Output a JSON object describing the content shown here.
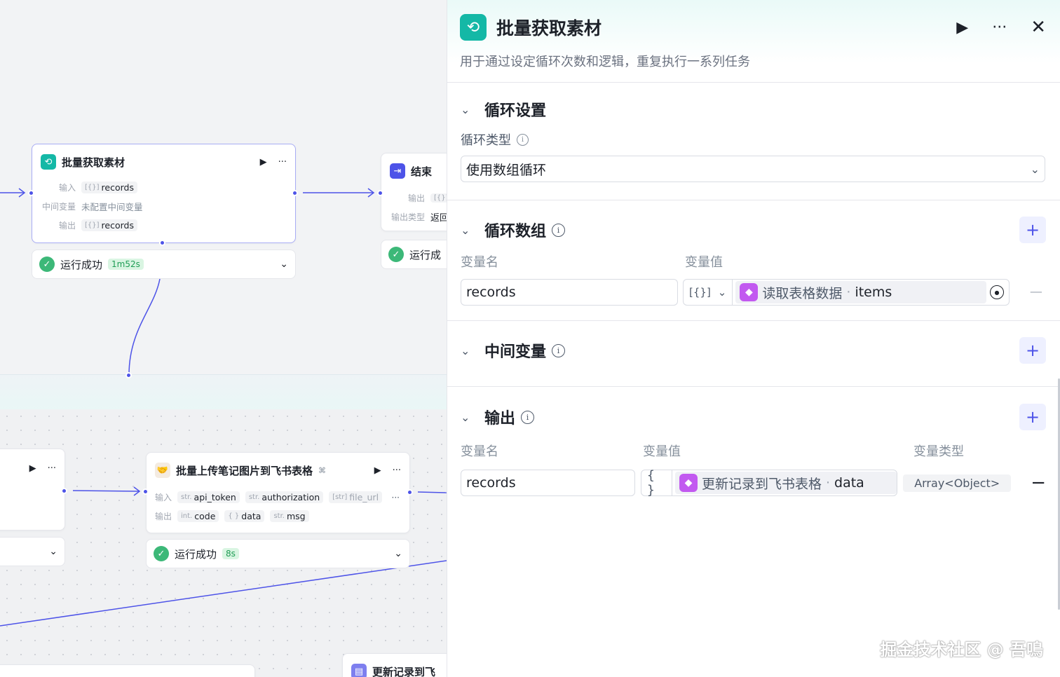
{
  "canvas": {
    "loop_node": {
      "title": "批量获取素材",
      "input_label": "输入",
      "input_type": "[{}]",
      "input_value": "records",
      "mid_label": "中间变量",
      "mid_value": "未配置中间变量",
      "output_label": "输出",
      "output_type": "[{}]",
      "output_value": "records",
      "status": "运行成功",
      "time": "1m52s"
    },
    "end_node": {
      "title": "结束",
      "output_label": "输出",
      "output_type": "[{}]",
      "output_type_label": "输出类型",
      "output_type_value": "返回",
      "status": "运行成"
    },
    "upload_node": {
      "title": "批量上传笔记图片到飞书表格",
      "input_label": "输入",
      "inputs": [
        {
          "type": "str.",
          "name": "api_token"
        },
        {
          "type": "str.",
          "name": "authorization"
        },
        {
          "type": "[str]",
          "name": "file_url"
        }
      ],
      "more": "···",
      "output_label": "输出",
      "outputs": [
        {
          "type": "int.",
          "name": "code"
        },
        {
          "type": "{ }",
          "name": "data"
        },
        {
          "type": "str.",
          "name": "msg"
        }
      ],
      "status": "运行成功",
      "time": "8s"
    },
    "bottom_node": {
      "title": "更新记录到飞"
    }
  },
  "panel": {
    "title": "批量获取素材",
    "description": "用于通过设定循环次数和逻辑，重复执行一系列任务",
    "loop_settings": {
      "title": "循环设置",
      "type_label": "循环类型",
      "type_value": "使用数组循环"
    },
    "loop_array": {
      "title": "循环数组",
      "col_name": "变量名",
      "col_value": "变量值",
      "var_name": "records",
      "type_glyph": "[{}]",
      "ref_node": "读取表格数据",
      "ref_sep": " · ",
      "ref_field": "items"
    },
    "mid_vars": {
      "title": "中间变量"
    },
    "output": {
      "title": "输出",
      "col_name": "变量名",
      "col_value": "变量值",
      "col_type": "变量类型",
      "var_name": "records",
      "type_glyph": "{ }",
      "ref_node": "更新记录到飞书表格",
      "ref_sep": " · ",
      "ref_field": "data",
      "var_type": "Array<Object>"
    }
  },
  "watermark": "掘金技术社区 @ 吾鳴",
  "colors": {
    "accent": "#4d53e8",
    "loop_icon": "#14b8a6",
    "success": "#3cb878",
    "ref_icon": "#c259f0"
  }
}
